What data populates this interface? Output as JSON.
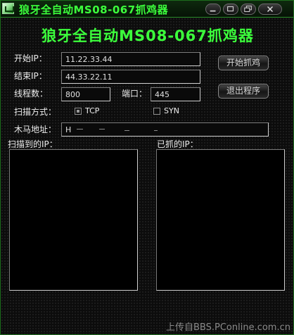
{
  "window": {
    "title": "狼牙全自动MS08-067抓鸡器"
  },
  "header": {
    "headline": "狼牙全自动MS08-067抓鸡器"
  },
  "form": {
    "start_ip_label": "开始IP：",
    "start_ip_value": "11.22.33.44",
    "end_ip_label": "结束IP：",
    "end_ip_value": "44.33.22.11",
    "threads_label": "线程数：",
    "threads_value": "800",
    "port_label": "端口：",
    "port_value": "445",
    "scan_mode_label": "扫描方式：",
    "tcp_label": "TCP",
    "tcp_checked": true,
    "syn_label": "SYN",
    "syn_checked": false,
    "trojan_label": "木马地址：",
    "trojan_value": "H"
  },
  "buttons": {
    "start": "开始抓鸡",
    "exit": "退出程序"
  },
  "lists": {
    "scanned_label": "扫描到的IP：",
    "captured_label": "已抓的IP："
  },
  "footer": {
    "watermark": "上传自BBS.PConline.com.cn"
  },
  "colors": {
    "accent": "#3cff3c",
    "background": "#0c0c0c"
  }
}
